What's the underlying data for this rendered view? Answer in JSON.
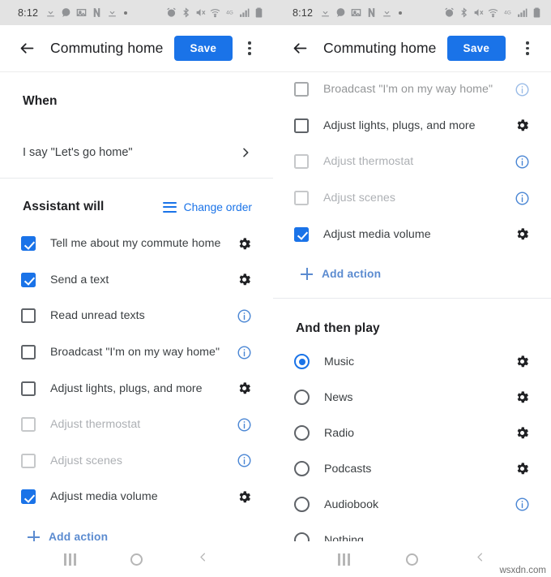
{
  "statusbar": {
    "time": "8:12",
    "left_icons": [
      "download-icon",
      "message-bubble-icon",
      "photo-icon",
      "netflix-n-icon",
      "download-icon",
      "dot-icon"
    ],
    "right_icons": [
      "alarm-icon",
      "bluetooth-icon",
      "mute-icon",
      "wifi-icon",
      "lte-icon",
      "signal-bars-icon",
      "battery-icon"
    ]
  },
  "appbar": {
    "back_icon": "arrow-left-icon",
    "title": "Commuting home",
    "save_label": "Save",
    "overflow_icon": "more-vertical-icon",
    "accent_color": "#1a73e8"
  },
  "left_screen": {
    "when": {
      "section_title": "When",
      "trigger_text": "I say \"Let's go home\"",
      "chevron_icon": "chevron-right-icon"
    },
    "assistant": {
      "section_title": "Assistant will",
      "change_order_label": "Change order",
      "change_order_icon": "reorder-icon",
      "actions": [
        {
          "label": "Tell me about my commute home",
          "checked": true,
          "disabled": false,
          "trailing": "gear-icon"
        },
        {
          "label": "Send a text",
          "checked": true,
          "disabled": false,
          "trailing": "gear-icon"
        },
        {
          "label": "Read unread texts",
          "checked": false,
          "disabled": false,
          "trailing": "info-icon"
        },
        {
          "label": "Broadcast \"I'm on my way home\"",
          "checked": false,
          "disabled": false,
          "trailing": "info-icon"
        },
        {
          "label": "Adjust lights, plugs, and more",
          "checked": false,
          "disabled": false,
          "trailing": "gear-icon"
        },
        {
          "label": "Adjust thermostat",
          "checked": false,
          "disabled": true,
          "trailing": "info-icon"
        },
        {
          "label": "Adjust scenes",
          "checked": false,
          "disabled": true,
          "trailing": "info-icon"
        },
        {
          "label": "Adjust media volume",
          "checked": true,
          "disabled": false,
          "trailing": "gear-icon"
        }
      ],
      "add_action_label": "Add action",
      "add_action_icon": "plus-icon"
    }
  },
  "right_screen": {
    "assistant": {
      "actions": [
        {
          "label": "Broadcast \"I'm on my way home\"",
          "checked": false,
          "disabled": false,
          "trailing": "info-icon"
        },
        {
          "label": "Adjust lights, plugs, and more",
          "checked": false,
          "disabled": false,
          "trailing": "gear-icon"
        },
        {
          "label": "Adjust thermostat",
          "checked": false,
          "disabled": true,
          "trailing": "info-icon"
        },
        {
          "label": "Adjust scenes",
          "checked": false,
          "disabled": true,
          "trailing": "info-icon"
        },
        {
          "label": "Adjust media volume",
          "checked": true,
          "disabled": false,
          "trailing": "gear-icon"
        }
      ],
      "add_action_label": "Add action",
      "add_action_icon": "plus-icon"
    },
    "play": {
      "section_title": "And then play",
      "options": [
        {
          "label": "Music",
          "selected": true,
          "trailing": "gear-icon"
        },
        {
          "label": "News",
          "selected": false,
          "trailing": "gear-icon"
        },
        {
          "label": "Radio",
          "selected": false,
          "trailing": "gear-icon"
        },
        {
          "label": "Podcasts",
          "selected": false,
          "trailing": "gear-icon"
        },
        {
          "label": "Audiobook",
          "selected": false,
          "trailing": "info-icon"
        },
        {
          "label": "Nothing",
          "selected": false,
          "trailing": "none"
        }
      ]
    }
  },
  "navbar": {
    "recents_icon": "recents-icon",
    "home_icon": "home-circle-icon",
    "back_icon": "back-chevron-icon"
  },
  "watermark": "wsxdn.com"
}
